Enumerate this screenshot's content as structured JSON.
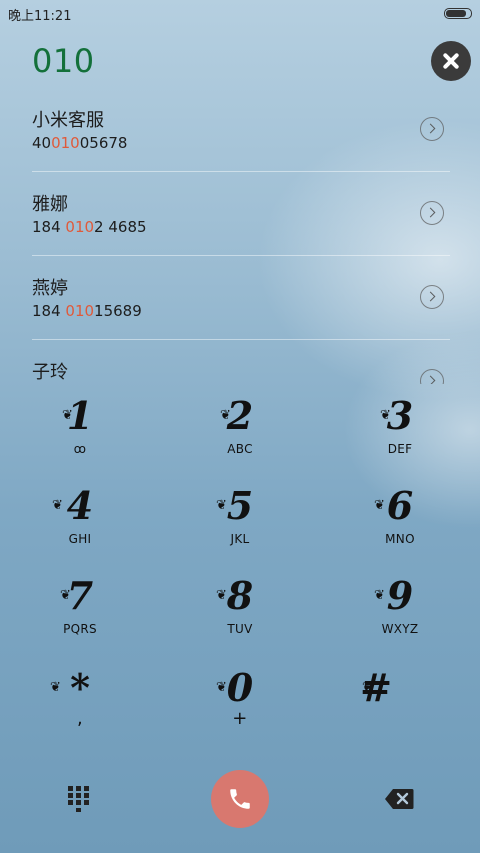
{
  "status": {
    "time": "晚上11:21",
    "battery_level": 1.0
  },
  "dialed_number": "010",
  "contacts": [
    {
      "name": "小米客服",
      "number_pre": "40",
      "number_match": "010",
      "number_post": "05678"
    },
    {
      "name": "雅娜",
      "number_pre": "184 ",
      "number_match": "010",
      "number_post": "2 4685"
    },
    {
      "name": "燕婷",
      "number_pre": "184 ",
      "number_match": "010",
      "number_post": "15689"
    },
    {
      "name": "子玲",
      "number_pre": "",
      "number_match": "",
      "number_post": ""
    }
  ],
  "keypad": {
    "k1": {
      "digit": "1",
      "sub": "ꝏ"
    },
    "k2": {
      "digit": "2",
      "sub": "ABC"
    },
    "k3": {
      "digit": "3",
      "sub": "DEF"
    },
    "k4": {
      "digit": "4",
      "sub": "GHI"
    },
    "k5": {
      "digit": "5",
      "sub": "JKL"
    },
    "k6": {
      "digit": "6",
      "sub": "MNO"
    },
    "k7": {
      "digit": "7",
      "sub": "PQRS"
    },
    "k8": {
      "digit": "8",
      "sub": "TUV"
    },
    "k9": {
      "digit": "9",
      "sub": "WXYZ"
    },
    "kstar": {
      "digit": "*",
      "sub": ","
    },
    "k0": {
      "digit": "0",
      "sub": "+"
    },
    "khash": {
      "digit": "#",
      "sub": ""
    }
  },
  "icons": {
    "close": "close-icon",
    "detail": "chevron-right-icon",
    "dialpad": "dialpad-icon",
    "call": "phone-icon",
    "backspace": "backspace-icon"
  },
  "colors": {
    "dialed_number": "#13703a",
    "match_highlight": "#e05a3a",
    "call_button": "#d8786f"
  }
}
